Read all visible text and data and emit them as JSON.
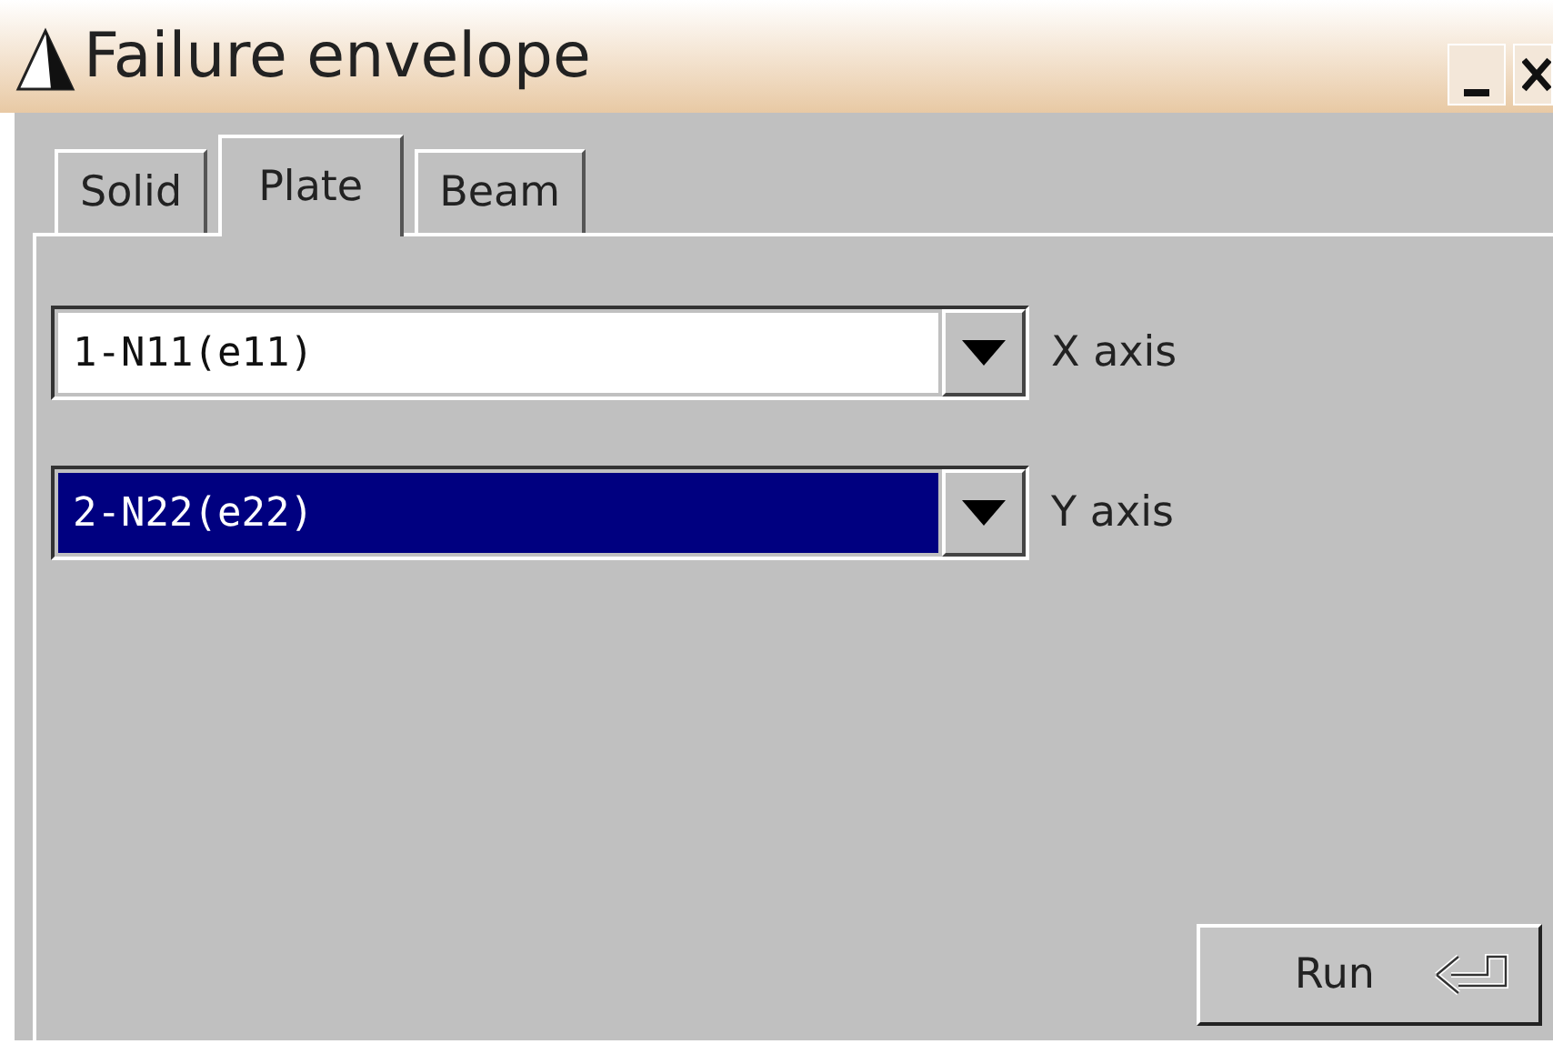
{
  "window": {
    "title": "Failure envelope"
  },
  "tabs": [
    {
      "label": "Solid",
      "selected": false
    },
    {
      "label": "Plate",
      "selected": true
    },
    {
      "label": "Beam",
      "selected": false
    }
  ],
  "fields": [
    {
      "value": "1-N11(e11)",
      "label": "X axis",
      "focused": false
    },
    {
      "value": "2-N22(e22)",
      "label": "Y axis",
      "focused": true
    }
  ],
  "run_button": {
    "label": "Run"
  }
}
